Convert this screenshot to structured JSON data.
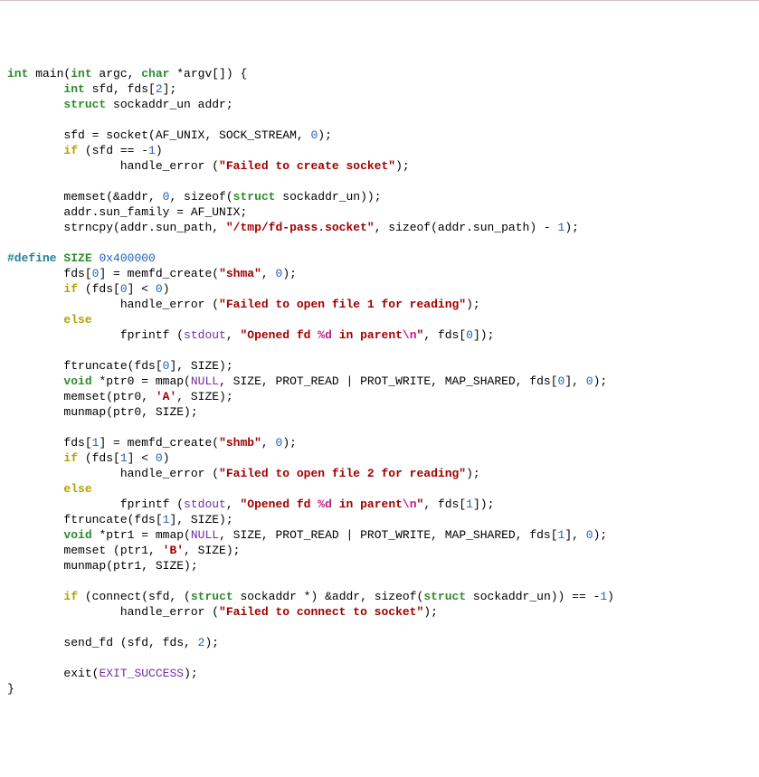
{
  "code": {
    "l1": {
      "t_int": "int",
      "s_main": " main(",
      "t_int2": "int",
      "s_argc": " argc, ",
      "t_char": "char",
      "s_rest": " *argv[]) {"
    },
    "l2": {
      "pad": "        ",
      "t_int": "int",
      "s": " sfd, fds[",
      "n": "2",
      "s2": "];"
    },
    "l3": {
      "pad": "        ",
      "t_struct": "struct",
      "s": " sockaddr_un addr;"
    },
    "l4": "",
    "l5": {
      "pad": "        ",
      "s1": "sfd = socket(AF_UNIX, SOCK_STREAM, ",
      "n": "0",
      "s2": ");"
    },
    "l6": {
      "pad": "        ",
      "kw": "if",
      "s1": " (sfd == -",
      "n": "1",
      "s2": ")"
    },
    "l7": {
      "pad": "                ",
      "s1": "handle_error (",
      "str": "\"Failed to create socket\"",
      "s2": ");"
    },
    "l8": "",
    "l9": {
      "pad": "        ",
      "s1": "memset(&addr, ",
      "n": "0",
      "s2": ", sizeof(",
      "t_struct": "struct",
      "s3": " sockaddr_un));"
    },
    "l10": {
      "pad": "        ",
      "s": "addr.sun_family = AF_UNIX;"
    },
    "l11": {
      "pad": "        ",
      "s1": "strncpy(addr.sun_path, ",
      "str": "\"/tmp/fd-pass.socket\"",
      "s2": ", sizeof(addr.sun_path) - ",
      "n": "1",
      "s3": ");"
    },
    "l12": "",
    "l13": {
      "def": "#define",
      "sp": " ",
      "name": "SIZE",
      "sp2": " ",
      "val": "0x400000"
    },
    "l14": {
      "pad": "        ",
      "s1": "fds[",
      "n0": "0",
      "s2": "] = memfd_create(",
      "str": "\"shma\"",
      "s3": ", ",
      "n": "0",
      "s4": ");"
    },
    "l15": {
      "pad": "        ",
      "kw": "if",
      "s1": " (fds[",
      "n": "0",
      "s2": "] < ",
      "n2": "0",
      "s3": ")"
    },
    "l16": {
      "pad": "                ",
      "s1": "handle_error (",
      "str": "\"Failed to open file 1 for reading\"",
      "s2": ");"
    },
    "l17": {
      "pad": "        ",
      "kw": "else"
    },
    "l18": {
      "pad": "                ",
      "s1": "fprintf (",
      "c": "stdout",
      "s2": ", ",
      "str1": "\"Opened fd ",
      "fmt1": "%d",
      "str2": " in parent",
      "fmt2": "\\n",
      "str3": "\"",
      "s3": ", fds[",
      "n": "0",
      "s4": "]);"
    },
    "l19": "",
    "l20": {
      "pad": "        ",
      "s1": "ftruncate(fds[",
      "n": "0",
      "s2": "], SIZE);"
    },
    "l21": {
      "pad": "        ",
      "t_void": "void",
      "s1": " *ptr0 = mmap(",
      "c": "NULL",
      "s2": ", SIZE, PROT_READ | PROT_WRITE, MAP_SHARED, fds[",
      "n": "0",
      "s3": "], ",
      "n2": "0",
      "s4": ");"
    },
    "l22": {
      "pad": "        ",
      "s1": "memset(ptr0, ",
      "ch": "'A'",
      "s2": ", SIZE);"
    },
    "l23": {
      "pad": "        ",
      "s": "munmap(ptr0, SIZE);"
    },
    "l24": "",
    "l25": {
      "pad": "        ",
      "s1": "fds[",
      "n0": "1",
      "s2": "] = memfd_create(",
      "str": "\"shmb\"",
      "s3": ", ",
      "n": "0",
      "s4": ");"
    },
    "l26": {
      "pad": "        ",
      "kw": "if",
      "s1": " (fds[",
      "n": "1",
      "s2": "] < ",
      "n2": "0",
      "s3": ")"
    },
    "l27": {
      "pad": "                ",
      "s1": "handle_error (",
      "str": "\"Failed to open file 2 for reading\"",
      "s2": ");"
    },
    "l28": {
      "pad": "        ",
      "kw": "else"
    },
    "l29": {
      "pad": "                ",
      "s1": "fprintf (",
      "c": "stdout",
      "s2": ", ",
      "str1": "\"Opened fd ",
      "fmt1": "%d",
      "str2": " in parent",
      "fmt2": "\\n",
      "str3": "\"",
      "s3": ", fds[",
      "n": "1",
      "s4": "]);"
    },
    "l30": {
      "pad": "        ",
      "s1": "ftruncate(fds[",
      "n": "1",
      "s2": "], SIZE);"
    },
    "l31": {
      "pad": "        ",
      "t_void": "void",
      "s1": " *ptr1 = mmap(",
      "c": "NULL",
      "s2": ", SIZE, PROT_READ | PROT_WRITE, MAP_SHARED, fds[",
      "n": "1",
      "s3": "], ",
      "n2": "0",
      "s4": ");"
    },
    "l32": {
      "pad": "        ",
      "s1": "memset (ptr1, ",
      "ch": "'B'",
      "s2": ", SIZE);"
    },
    "l33": {
      "pad": "        ",
      "s": "munmap(ptr1, SIZE);"
    },
    "l34": "",
    "l35": {
      "pad": "        ",
      "kw": "if",
      "s1": " (connect(sfd, (",
      "t_struct": "struct",
      "s2": " sockaddr *) &addr, sizeof(",
      "t_struct2": "struct",
      "s3": " sockaddr_un)) == -",
      "n": "1",
      "s4": ")"
    },
    "l36": {
      "pad": "                ",
      "s1": "handle_error (",
      "str": "\"Failed to connect to socket\"",
      "s2": ");"
    },
    "l37": "",
    "l38": {
      "pad": "        ",
      "s1": "send_fd (sfd, fds, ",
      "n": "2",
      "s2": ");"
    },
    "l39": "",
    "l40": {
      "pad": "        ",
      "s1": "exit(",
      "c": "EXIT_SUCCESS",
      "s2": ");"
    },
    "l41": "}"
  }
}
